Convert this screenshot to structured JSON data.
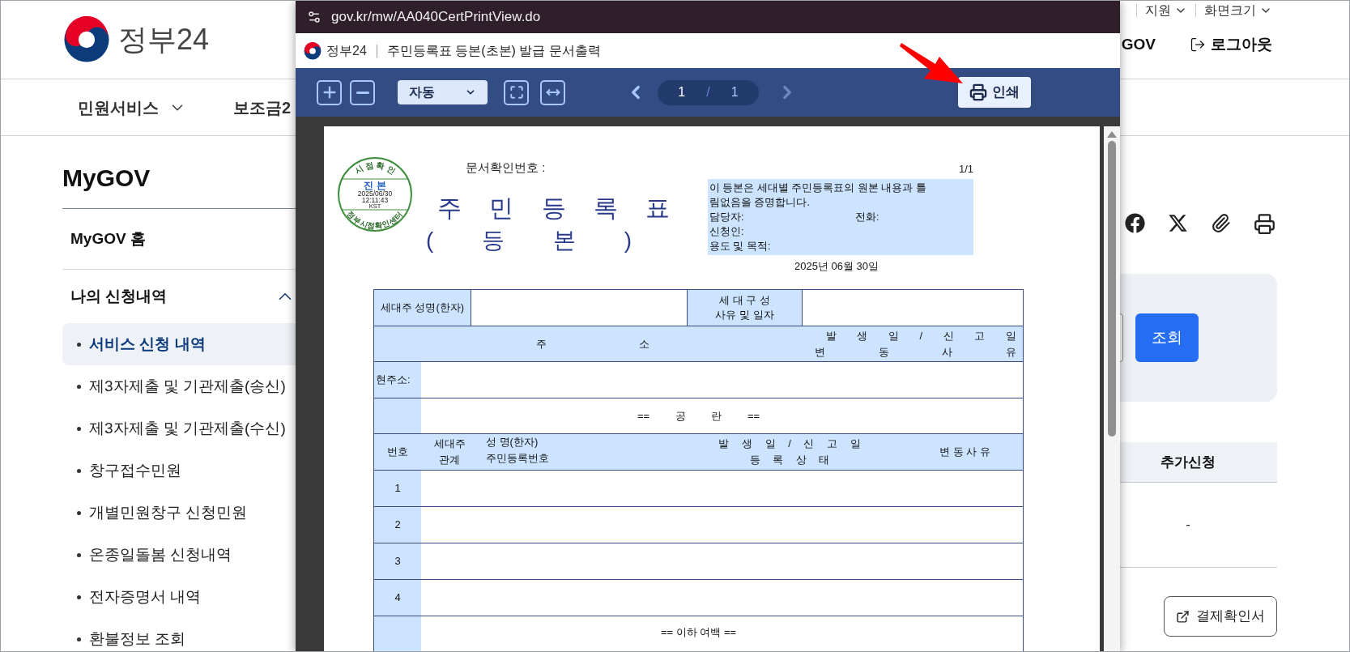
{
  "site": {
    "logo_text": "정부24",
    "utility_links": [
      {
        "label": "지원"
      },
      {
        "label": "화면크기"
      }
    ],
    "account_links": [
      {
        "kind": "text",
        "label": "GOV"
      },
      {
        "kind": "logout",
        "label": "로그아웃"
      }
    ]
  },
  "nav": [
    {
      "label": "민원서비스",
      "dropdown": true
    },
    {
      "label": "보조금2",
      "dropdown": false
    }
  ],
  "sidebar": {
    "title": "MyGOV",
    "items": [
      {
        "kind": "link",
        "label": "MyGOV 홈"
      },
      {
        "kind": "group",
        "label": "나의 신청내역",
        "expanded": true,
        "children": [
          {
            "label": "서비스 신청 내역",
            "selected": true
          },
          {
            "label": "제3자제출 및 기관제출(송신)",
            "selected": false
          },
          {
            "label": "제3자제출 및 기관제출(수신)",
            "selected": false
          },
          {
            "label": "창구접수민원",
            "selected": false
          },
          {
            "label": "개별민원창구 신청민원",
            "selected": false
          },
          {
            "label": "온종일돌봄 신청내역",
            "selected": false
          },
          {
            "label": "전자증명서 내역",
            "selected": false
          },
          {
            "label": "환불정보 조회",
            "selected": false
          }
        ]
      }
    ]
  },
  "main": {
    "share_icons": [
      {
        "kind": "facebook"
      },
      {
        "kind": "x"
      },
      {
        "kind": "clip"
      },
      {
        "kind": "print"
      }
    ],
    "search_button": "조회",
    "table": {
      "columns": [
        "추가신청"
      ],
      "rows": [
        [
          "-"
        ]
      ]
    },
    "receipt_button": "결제확인서"
  },
  "popup": {
    "url": "gov.kr/mw/AA040CertPrintView.do",
    "brand": "정부24",
    "title": "주민등록표 등본(초본) 발급 문서출력",
    "toolbar": {
      "zoom_mode": "자동",
      "page": "1",
      "page_separator": "/",
      "page_total": "1",
      "next_disabled": true,
      "print_button": "인쇄"
    },
    "document": {
      "doc_number_label": "문서확인번호 :",
      "page_count": "1/1",
      "title": "주 민 등 록 표",
      "subtitle": "( 등 본 )",
      "stamp": {
        "top": "시 점 확 인",
        "middle": "진 본",
        "date": "2025/06/30",
        "time": "12:11:43",
        "zone": "KST",
        "bottom": "정부시점확인센터"
      },
      "certificate": {
        "statement": "이 등본은 세대별 주민등록표의 원본 내용과 틀림없음을 증명합니다.",
        "lines": [
          [
            "담당자:",
            "전화:"
          ],
          [
            "신청인:"
          ],
          [
            "용도 및 목적:"
          ]
        ]
      },
      "issue_date": "2025년 06월 30일",
      "table": {
        "householder_label": "세대주 성명(한자)",
        "composition_label": [
          "세 대 구 성",
          "사유 및 일자"
        ],
        "address_header": "주 소",
        "address_date_header": [
          "발 생 일 / 신 고 일",
          "변 동 사 유"
        ],
        "current_address_label": "현주소:",
        "blank_note": "== 공 란 ==",
        "member_columns": [
          [
            "번호"
          ],
          [
            "세대주",
            "관계"
          ],
          [
            "성 명(한자)",
            "주민등록번호"
          ],
          [
            "발 생 일 / 신 고 일",
            "등 록 상 태"
          ],
          [
            "변 동 사 유"
          ]
        ],
        "member_rows": [
          "1",
          "2",
          "3",
          "4"
        ],
        "end_note": "== 이하 여백 =="
      }
    }
  }
}
